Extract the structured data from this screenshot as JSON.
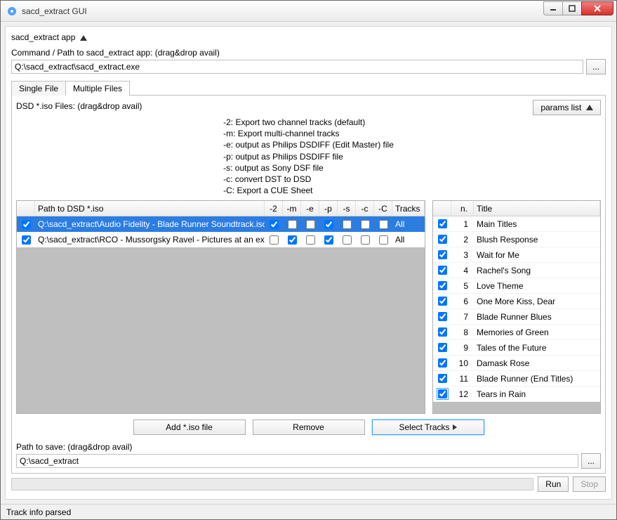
{
  "window": {
    "title": "sacd_extract GUI"
  },
  "header": {
    "app_label": "sacd_extract app"
  },
  "command": {
    "label": "Command / Path to sacd_extract app: (drag&drop avail)",
    "value": "Q:\\sacd_extract\\sacd_extract.exe",
    "browse": "..."
  },
  "tabs": {
    "single": "Single File",
    "multiple": "Multiple Files"
  },
  "dsd": {
    "label": "DSD *.iso Files: (drag&drop avail)",
    "params_btn": "params list"
  },
  "help": "-2: Export two channel tracks (default)\n-m: Export multi-channel tracks\n-e: output as Philips DSDIFF (Edit Master) file\n-p: output as Philips DSDIFF file\n-s: output as Sony DSF file\n-c: convert DST to DSD\n-C: Export a CUE Sheet",
  "iso_table": {
    "headers": {
      "path": "Path to DSD *.iso",
      "f2": "-2",
      "fm": "-m",
      "fe": "-e",
      "fp": "-p",
      "fs": "-s",
      "fc": "-c",
      "fC": "-C",
      "tracks": "Tracks"
    },
    "rows": [
      {
        "checked": true,
        "selected": true,
        "path": "Q:\\sacd_extract\\Audio Fidelity - Blade Runner Soundtrack.iso",
        "f2": true,
        "fm": false,
        "fe": false,
        "fp": true,
        "fs": false,
        "fc": false,
        "fC": false,
        "tracks": "All"
      },
      {
        "checked": true,
        "selected": false,
        "path": "Q:\\sacd_extract\\RCO - Mussorgsky Ravel - Pictures at an exhibition.iso",
        "f2": false,
        "fm": true,
        "fe": false,
        "fp": true,
        "fs": false,
        "fc": false,
        "fC": false,
        "tracks": "All"
      }
    ]
  },
  "track_table": {
    "headers": {
      "n": "n.",
      "title": "Title"
    },
    "rows": [
      {
        "checked": true,
        "n": "1",
        "title": "Main Titles"
      },
      {
        "checked": true,
        "n": "2",
        "title": "Blush Response"
      },
      {
        "checked": true,
        "n": "3",
        "title": "Wait for Me"
      },
      {
        "checked": true,
        "n": "4",
        "title": "Rachel's Song"
      },
      {
        "checked": true,
        "n": "5",
        "title": "Love Theme"
      },
      {
        "checked": true,
        "n": "6",
        "title": "One More Kiss, Dear"
      },
      {
        "checked": true,
        "n": "7",
        "title": "Blade Runner Blues"
      },
      {
        "checked": true,
        "n": "8",
        "title": "Memories of Green"
      },
      {
        "checked": true,
        "n": "9",
        "title": "Tales of the Future"
      },
      {
        "checked": true,
        "n": "10",
        "title": "Damask Rose"
      },
      {
        "checked": true,
        "n": "11",
        "title": "Blade Runner (End Titles)"
      },
      {
        "checked": true,
        "n": "12",
        "title": "Tears in Rain"
      }
    ]
  },
  "buttons": {
    "add": "Add *.iso file",
    "remove": "Remove",
    "select_tracks": "Select Tracks"
  },
  "save": {
    "label": "Path to save: (drag&drop avail)",
    "value": "Q:\\sacd_extract",
    "browse": "..."
  },
  "run": {
    "run": "Run",
    "stop": "Stop"
  },
  "status": "Track info parsed"
}
